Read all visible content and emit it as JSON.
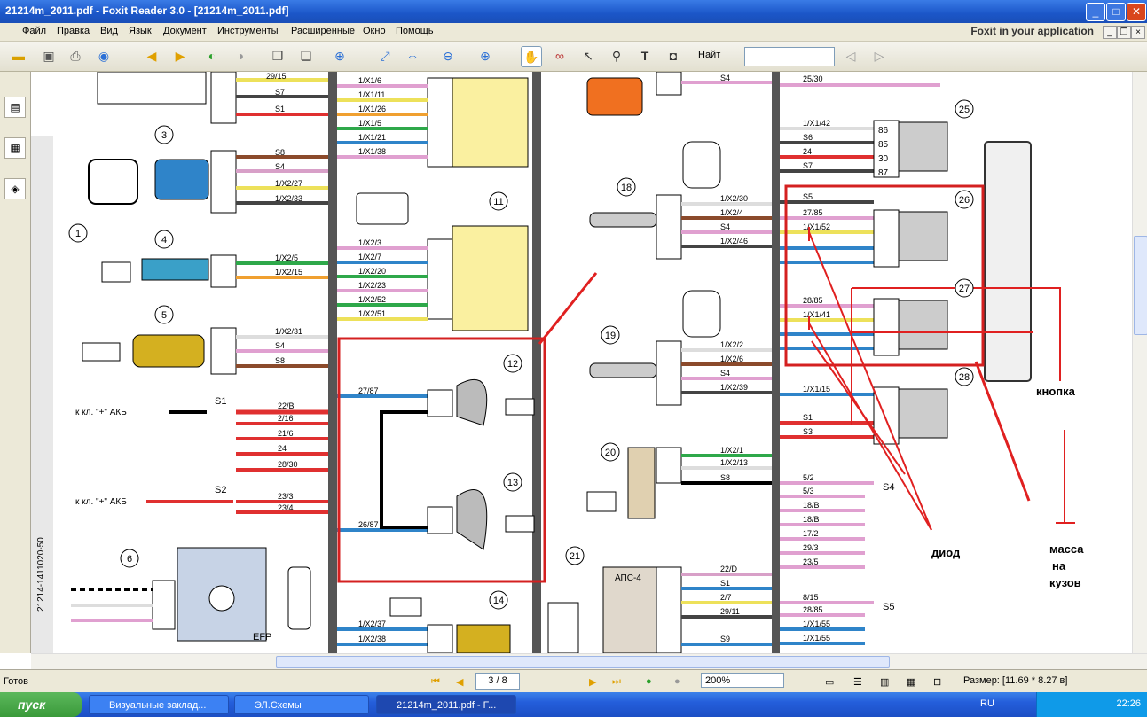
{
  "window": {
    "title": "21214m_2011.pdf - Foxit Reader 3.0 - [21214m_2011.pdf]",
    "min": "_",
    "max": "□",
    "close": "✕"
  },
  "menu": {
    "items": [
      "Файл",
      "Правка",
      "Вид",
      "Язык",
      "Документ",
      "Инструменты",
      "Расширенные",
      "Окно",
      "Помощь"
    ],
    "brand": "Foxit in your application"
  },
  "toolbar": {
    "find_label": "Найт",
    "find_value": ""
  },
  "doc": {
    "labels": {
      "akb1": "к кл. \"+\" АКБ",
      "akb2": "к кл. \"+\" АКБ",
      "s1": "S1",
      "s2": "S2",
      "s4": "S4",
      "s5": "S5",
      "efp": "EFP",
      "aps": "АПС-4",
      "side": "21214-1411020-50",
      "knopka": "кнопка",
      "diod": "диод",
      "massa1": "масса",
      "massa2": "на",
      "massa3": "кузов"
    },
    "left_wires": [
      "29/15",
      "S7",
      "S1",
      "S8",
      "S4",
      "1/X2/27",
      "1/X2/33",
      "1/X2/5",
      "1/X2/15",
      "1/X2/31",
      "S4",
      "S8",
      "22/B",
      "2/16",
      "21/6",
      "24",
      "28/30",
      "23/3",
      "23/4"
    ],
    "mid_wires": [
      "1/X1/6",
      "1/X1/11",
      "1/X1/26",
      "1/X1/5",
      "1/X1/21",
      "1/X1/38",
      "1/X2/3",
      "1/X2/7",
      "1/X2/20",
      "1/X2/23",
      "1/X2/52",
      "1/X2/51",
      "27/87",
      "26/87",
      "1/X2/37",
      "1/X2/38"
    ],
    "right_wires": [
      "S4",
      "1/X2/30",
      "1/X2/4",
      "S4",
      "1/X2/46",
      "1/X2/2",
      "1/X2/6",
      "S4",
      "1/X2/39",
      "1/X2/1",
      "1/X2/13",
      "S8",
      "22/D",
      "S1",
      "2/7",
      "29/11",
      "S9"
    ],
    "far_wires": [
      "25/30",
      "1/X1/42",
      "S6",
      "24",
      "S7",
      "S5",
      "27/85",
      "1/X1/52",
      "28/85",
      "1/X1/41",
      "1/X1/15",
      "S1",
      "S3",
      "5/2",
      "5/3",
      "18/B",
      "18/B",
      "17/2",
      "29/3",
      "23/5",
      "8/15",
      "28/85",
      "1/X1/55",
      "1/X1/55",
      "1/X1/56"
    ],
    "relay_pins": [
      "86",
      "85",
      "30",
      "87"
    ],
    "numbers": [
      "1",
      "3",
      "4",
      "5",
      "6",
      "11",
      "12",
      "13",
      "14",
      "18",
      "19",
      "20",
      "21",
      "25",
      "26",
      "27",
      "28"
    ]
  },
  "status": {
    "ready": "Готов",
    "page": "3 / 8",
    "zoom": "200%",
    "size": "Размер: [11.69 * 8.27 в]"
  },
  "taskbar": {
    "start": "пуск",
    "tasks": [
      "Визуальные заклад...",
      "ЭЛ.Схемы",
      "21214m_2011.pdf - F..."
    ],
    "lang": "RU",
    "clock": "22:26"
  }
}
